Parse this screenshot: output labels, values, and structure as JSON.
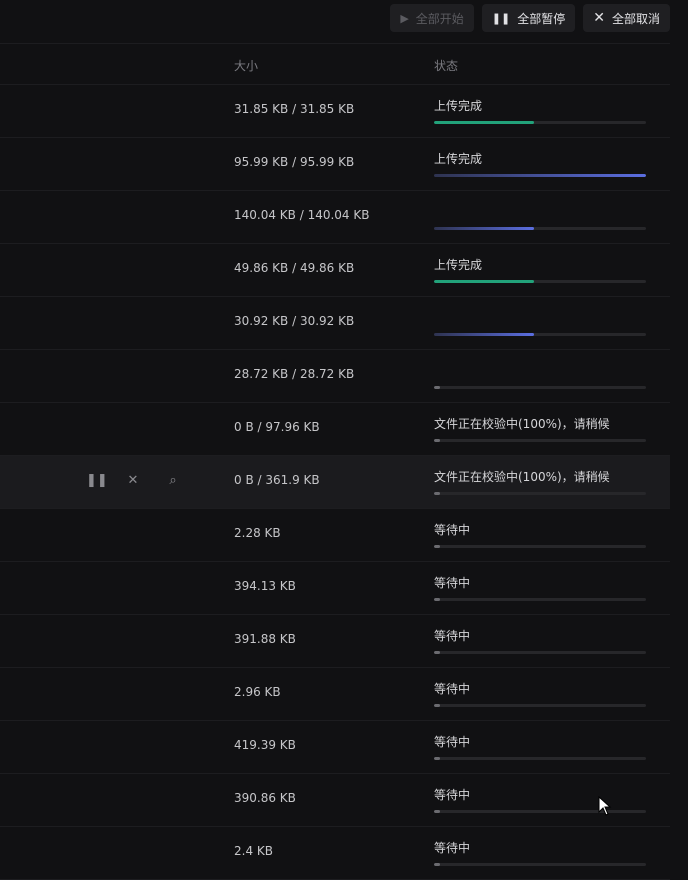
{
  "toolbar": {
    "start_all": "全部开始",
    "pause_all": "全部暂停",
    "cancel_all": "全部取消",
    "icons": {
      "start": "play-icon",
      "pause": "pause-icon",
      "cancel": "close-icon"
    }
  },
  "headers": {
    "size": "大小",
    "status": "状态"
  },
  "row_actions": {
    "icons": [
      "pause-icon",
      "close-icon",
      "search-icon"
    ]
  },
  "colors": {
    "background": "#111113",
    "success": "#22a27a",
    "progress": "#5b6ee1",
    "track": "#27272a"
  },
  "rows": [
    {
      "size": "31.85 KB / 31.85 KB",
      "status": "上传完成",
      "progress": 0.47,
      "color": "#22a27a"
    },
    {
      "size": "95.99 KB / 95.99 KB",
      "status": "上传完成",
      "progress": 1.0,
      "color": "#5b6ee1",
      "gradient": true
    },
    {
      "size": "140.04 KB / 140.04 KB",
      "status": "",
      "progress": 0.47,
      "color": "#5b6ee1",
      "gradient": true
    },
    {
      "size": "49.86 KB / 49.86 KB",
      "status": "上传完成",
      "progress": 0.47,
      "color": "#22a27a"
    },
    {
      "size": "30.92 KB / 30.92 KB",
      "status": "",
      "progress": 0.47,
      "color": "#5b6ee1",
      "gradient": true
    },
    {
      "size": "28.72 KB / 28.72 KB",
      "status": "",
      "progress": 0.03,
      "color": "#6b6b70"
    },
    {
      "size": "0 B / 97.96 KB",
      "status": "文件正在校验中(100%)，请稍候",
      "progress": 0.03,
      "color": "#6b6b70"
    },
    {
      "size": "0 B / 361.9 KB",
      "status": "文件正在校验中(100%)，请稍候",
      "progress": 0.03,
      "color": "#6b6b70",
      "highlight": true
    },
    {
      "size": "2.28 KB",
      "status": "等待中",
      "progress": 0.03,
      "color": "#6b6b70"
    },
    {
      "size": "394.13 KB",
      "status": "等待中",
      "progress": 0.03,
      "color": "#6b6b70"
    },
    {
      "size": "391.88 KB",
      "status": "等待中",
      "progress": 0.03,
      "color": "#6b6b70"
    },
    {
      "size": "2.96 KB",
      "status": "等待中",
      "progress": 0.03,
      "color": "#6b6b70"
    },
    {
      "size": "419.39 KB",
      "status": "等待中",
      "progress": 0.03,
      "color": "#6b6b70"
    },
    {
      "size": "390.86 KB",
      "status": "等待中",
      "progress": 0.03,
      "color": "#6b6b70"
    },
    {
      "size": "2.4 KB",
      "status": "等待中",
      "progress": 0.03,
      "color": "#6b6b70"
    }
  ]
}
